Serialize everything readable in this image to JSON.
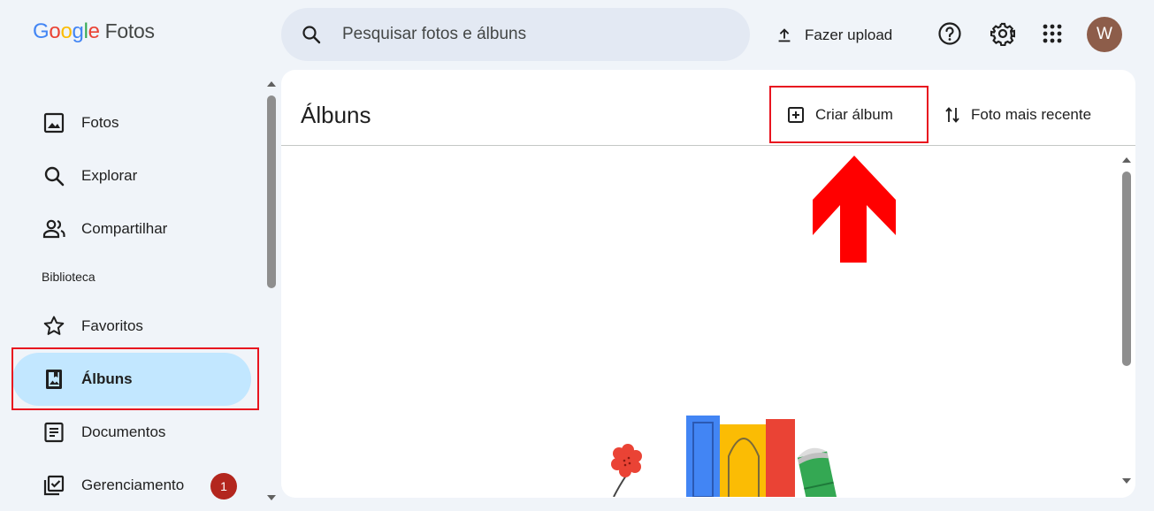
{
  "header": {
    "logo_letters": [
      "G",
      "o",
      "o",
      "g",
      "l",
      "e"
    ],
    "product_name": "Fotos",
    "search_placeholder": "Pesquisar fotos e álbuns",
    "upload_label": "Fazer upload",
    "avatar_initial": "W"
  },
  "sidebar": {
    "items": [
      {
        "label": "Fotos",
        "icon": "photo-icon"
      },
      {
        "label": "Explorar",
        "icon": "search-icon"
      },
      {
        "label": "Compartilhar",
        "icon": "people-icon"
      }
    ],
    "section_label": "Biblioteca",
    "library_items": [
      {
        "label": "Favoritos",
        "icon": "star-icon"
      },
      {
        "label": "Álbuns",
        "icon": "album-icon",
        "active": true
      },
      {
        "label": "Documentos",
        "icon": "document-icon"
      },
      {
        "label": "Gerenciamento",
        "icon": "manage-icon",
        "badge": "1"
      }
    ]
  },
  "main": {
    "title": "Álbuns",
    "create_album_label": "Criar álbum",
    "sort_label": "Foto mais recente"
  },
  "colors": {
    "accent_active": "#c2e7ff",
    "highlight_red": "#e8141f",
    "badge": "#b3261e",
    "avatar": "#8d5d4a"
  }
}
